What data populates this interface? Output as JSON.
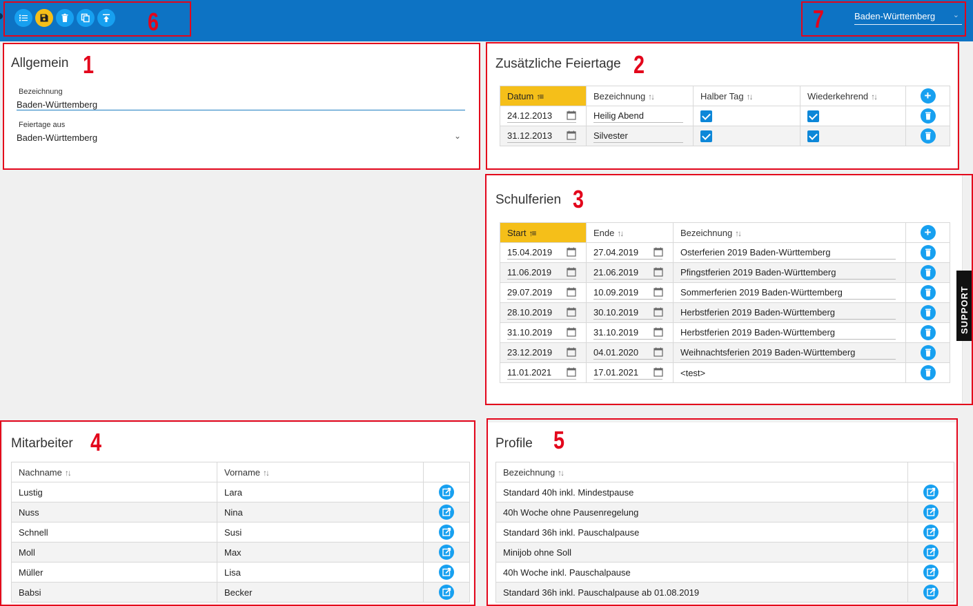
{
  "toolbar": {
    "buttons": [
      {
        "icon": "list-icon",
        "label": "Liste"
      },
      {
        "icon": "save-icon",
        "label": "Speichern"
      },
      {
        "icon": "trash-icon",
        "label": "Löschen"
      },
      {
        "icon": "copy-icon",
        "label": "Kopieren"
      },
      {
        "icon": "upload-icon",
        "label": "Hochladen"
      }
    ],
    "region_select": "Baden-Württemberg"
  },
  "annotations": [
    "1",
    "2",
    "3",
    "4",
    "5",
    "6",
    "7"
  ],
  "allgemein": {
    "title": "Allgemein",
    "bezeichnung_label": "Bezeichnung",
    "bezeichnung_value": "Baden-Württemberg",
    "feiertage_label": "Feiertage aus",
    "feiertage_value": "Baden-Württemberg"
  },
  "feiertage": {
    "title": "Zusätzliche Feiertage",
    "headers": [
      "Datum",
      "Bezeichnung",
      "Halber Tag",
      "Wiederkehrend"
    ],
    "rows": [
      {
        "datum": "24.12.2013",
        "bezeichnung": "Heilig Abend",
        "halber_tag": true,
        "wiederkehrend": true
      },
      {
        "datum": "31.12.2013",
        "bezeichnung": "Silvester",
        "halber_tag": true,
        "wiederkehrend": true
      }
    ]
  },
  "schulferien": {
    "title": "Schulferien",
    "headers": [
      "Start",
      "Ende",
      "Bezeichnung"
    ],
    "rows": [
      {
        "start": "15.04.2019",
        "ende": "27.04.2019",
        "bezeichnung": "Osterferien 2019 Baden-Württemberg"
      },
      {
        "start": "11.06.2019",
        "ende": "21.06.2019",
        "bezeichnung": "Pfingstferien 2019 Baden-Württemberg"
      },
      {
        "start": "29.07.2019",
        "ende": "10.09.2019",
        "bezeichnung": "Sommerferien 2019 Baden-Württemberg"
      },
      {
        "start": "28.10.2019",
        "ende": "30.10.2019",
        "bezeichnung": "Herbstferien 2019 Baden-Württemberg"
      },
      {
        "start": "31.10.2019",
        "ende": "31.10.2019",
        "bezeichnung": "Herbstferien 2019 Baden-Württemberg"
      },
      {
        "start": "23.12.2019",
        "ende": "04.01.2020",
        "bezeichnung": "Weihnachtsferien 2019 Baden-Württemberg"
      },
      {
        "start": "11.01.2021",
        "ende": "17.01.2021",
        "bezeichnung": "<test>"
      }
    ]
  },
  "mitarbeiter": {
    "title": "Mitarbeiter",
    "headers": [
      "Nachname",
      "Vorname"
    ],
    "rows": [
      {
        "nachname": "Lustig",
        "vorname": "Lara"
      },
      {
        "nachname": "Nuss",
        "vorname": "Nina"
      },
      {
        "nachname": "Schnell",
        "vorname": "Susi"
      },
      {
        "nachname": "Moll",
        "vorname": "Max"
      },
      {
        "nachname": "Müller",
        "vorname": "Lisa"
      },
      {
        "nachname": "Babsi",
        "vorname": "Becker"
      }
    ]
  },
  "profile": {
    "title": "Profile",
    "headers": [
      "Bezeichnung"
    ],
    "rows": [
      "Standard 40h inkl. Mindestpause",
      "40h Woche ohne Pausenregelung",
      "Standard 36h inkl. Pauschalpause",
      "Minijob ohne Soll",
      "40h Woche inkl. Pauschalpause",
      "Standard 36h inkl. Pauschalpause ab 01.08.2019"
    ]
  },
  "support_tab": "SUPPORT",
  "colors": {
    "topbar": "#0d73c4",
    "accent": "#17a0f0",
    "sorted_header": "#f5bf19",
    "annotation": "#e3051b"
  }
}
